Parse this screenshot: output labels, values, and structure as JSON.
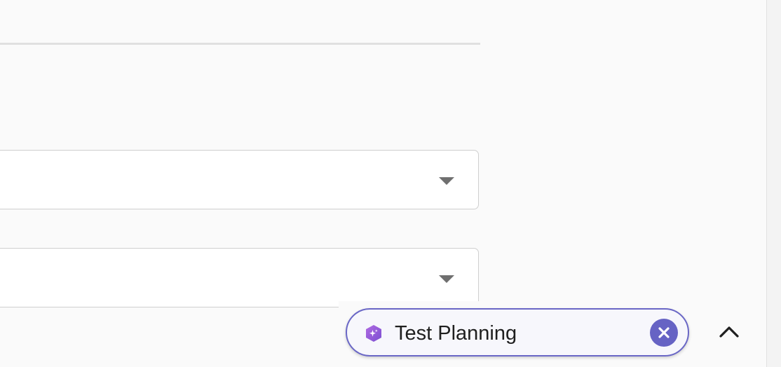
{
  "panel": {
    "chip": {
      "label": "Test Planning",
      "icon": "sparkle-hexagon-icon",
      "close_icon": "close-icon",
      "accent_color": "#6663c4",
      "border_color": "#6a67c6"
    },
    "collapse_icon": "chevron-up-icon",
    "selects": [
      {
        "name": "select-1",
        "caret_icon": "caret-down-icon"
      },
      {
        "name": "select-2",
        "caret_icon": "caret-down-icon"
      }
    ]
  }
}
